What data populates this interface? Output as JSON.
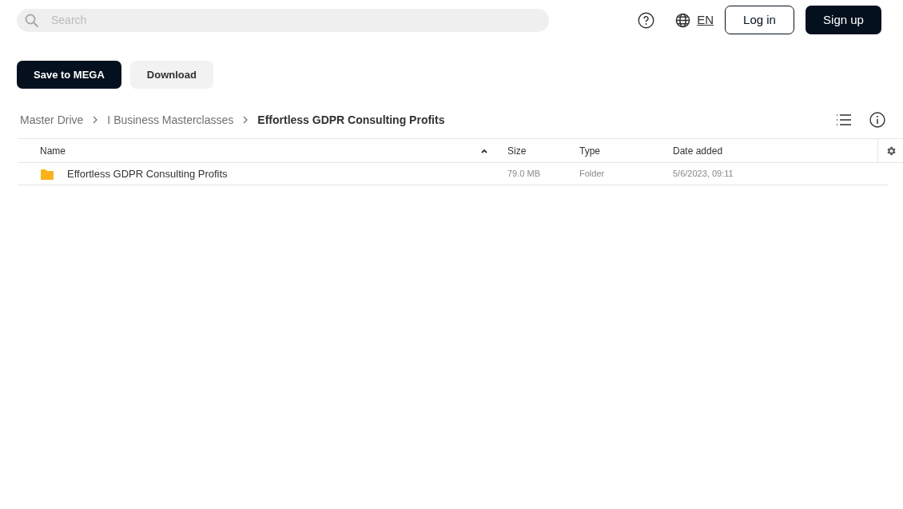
{
  "search": {
    "placeholder": "Search"
  },
  "header": {
    "language": "EN",
    "login": "Log in",
    "signup": "Sign up"
  },
  "actions": [
    "Save to MEGA",
    "Download"
  ],
  "breadcrumb": [
    {
      "label": "Master Drive",
      "current": false
    },
    {
      "label": "I Business Masterclasses",
      "current": false
    },
    {
      "label": "Effortless GDPR Consulting Profits",
      "current": true
    }
  ],
  "table": {
    "columns": [
      {
        "label": "Name",
        "sorted": true
      },
      {
        "label": "Size",
        "sorted": false
      },
      {
        "label": "Type",
        "sorted": false
      },
      {
        "label": "Date added",
        "sorted": false
      }
    ],
    "rows": [
      {
        "kind": "folder",
        "name": "Effortless GDPR Consulting Profits",
        "size": "79.0 MB",
        "type": "Folder",
        "date": "5/6/2023, 09:11"
      }
    ]
  }
}
